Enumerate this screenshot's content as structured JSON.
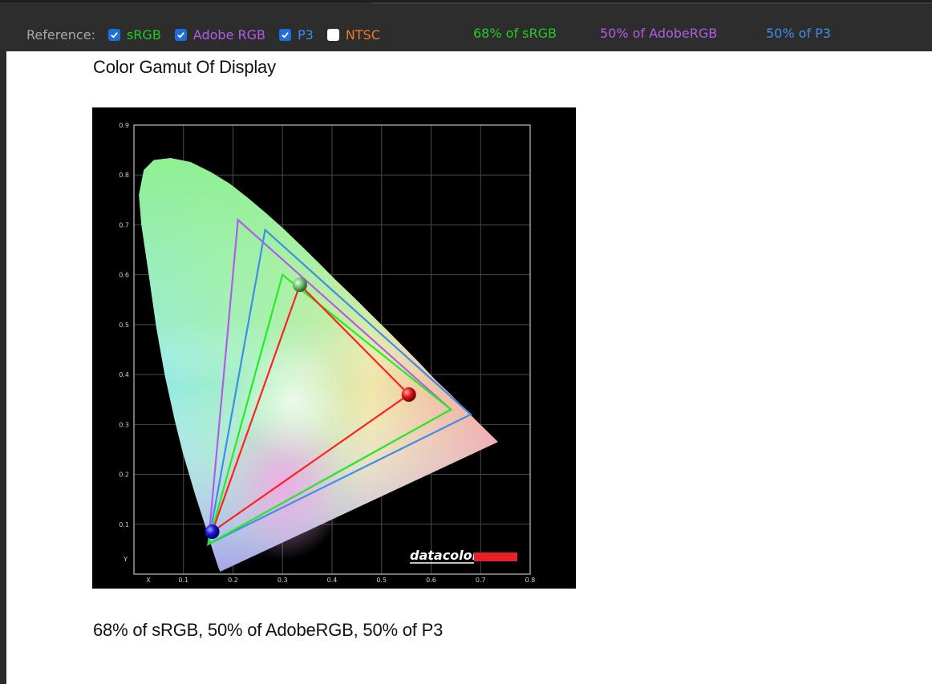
{
  "toolbar": {
    "reference_label": "Reference:",
    "options": [
      {
        "label": "sRGB",
        "checked": true,
        "color": "#22cc22"
      },
      {
        "label": "Adobe RGB",
        "checked": true,
        "color": "#b05ce8"
      },
      {
        "label": "P3",
        "checked": true,
        "color": "#3d8ee8"
      },
      {
        "label": "NTSC",
        "checked": false,
        "color": "#f07a28"
      }
    ],
    "coverage": [
      {
        "text": "68% of sRGB",
        "color": "#22cc22"
      },
      {
        "text": "50% of AdobeRGB",
        "color": "#b05ce8"
      },
      {
        "text": "50% of P3",
        "color": "#3d8ee8"
      }
    ]
  },
  "page": {
    "title": "Color Gamut Of Display",
    "caption": "68% of sRGB, 50% of AdobeRGB, 50% of P3"
  },
  "chart_data": {
    "type": "scatter",
    "title": "",
    "xlabel": "X",
    "ylabel": "Y",
    "xlim": [
      0,
      0.8
    ],
    "ylim": [
      0,
      0.9
    ],
    "x_ticks": [
      0.1,
      0.2,
      0.3,
      0.4,
      0.5,
      0.6,
      0.7,
      0.8
    ],
    "y_ticks": [
      0.1,
      0.2,
      0.3,
      0.4,
      0.5,
      0.6,
      0.7,
      0.8,
      0.9
    ],
    "grid": true,
    "watermark": "datacolor",
    "series": [
      {
        "name": "Adobe RGB",
        "color": "#b05ce8",
        "points": [
          [
            0.64,
            0.33
          ],
          [
            0.21,
            0.71
          ],
          [
            0.15,
            0.06
          ]
        ]
      },
      {
        "name": "P3",
        "color": "#3d8ee8",
        "points": [
          [
            0.68,
            0.32
          ],
          [
            0.265,
            0.69
          ],
          [
            0.15,
            0.06
          ]
        ]
      },
      {
        "name": "sRGB",
        "color": "#22ee22",
        "points": [
          [
            0.64,
            0.33
          ],
          [
            0.3,
            0.6
          ],
          [
            0.15,
            0.06
          ]
        ]
      },
      {
        "name": "",
        "color": "#ff2020",
        "points": [
          [
            0.555,
            0.36
          ],
          [
            0.335,
            0.58
          ],
          [
            0.158,
            0.085
          ]
        ]
      }
    ]
  }
}
